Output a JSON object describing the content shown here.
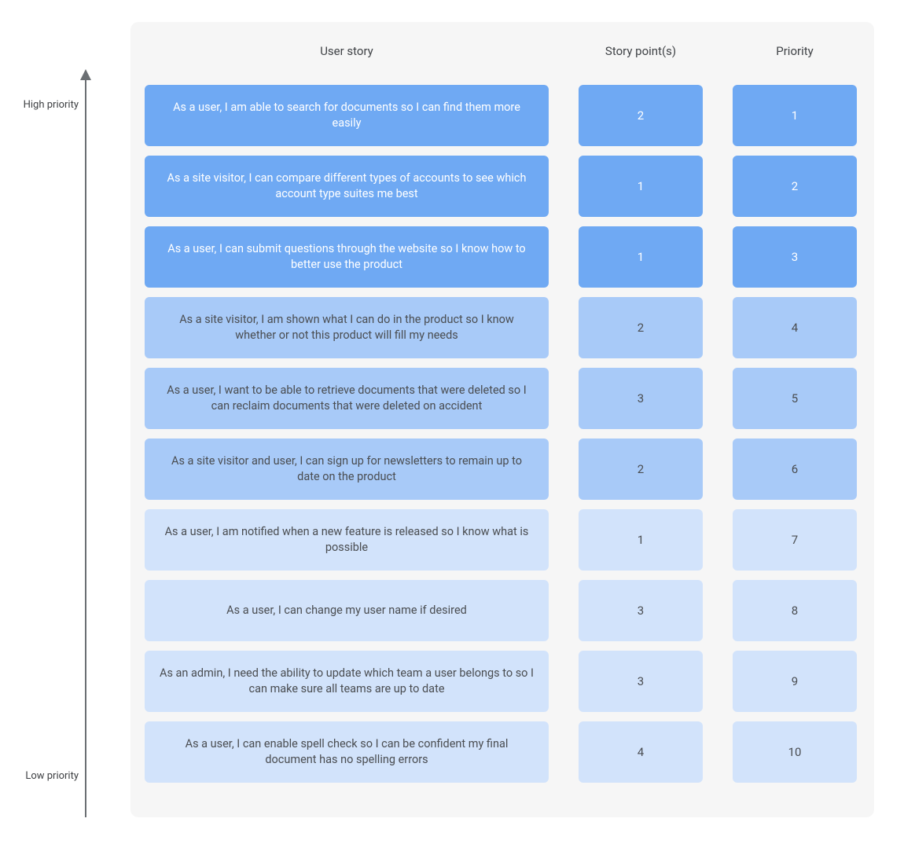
{
  "axis": {
    "high_label": "High priority",
    "low_label": "Low priority"
  },
  "headers": {
    "story": "User story",
    "points": "Story point(s)",
    "priority": "Priority"
  },
  "tiers": {
    "dark": "#6fa9f3",
    "mid": "#a8caf8",
    "light": "#d2e3fb"
  },
  "stories": [
    {
      "story": "As a user, I am able to search for documents so I can find them more easily",
      "points": "2",
      "priority": "1",
      "tier": "dark"
    },
    {
      "story": "As a site visitor, I can compare different types of accounts to see which account type suites me best",
      "points": "1",
      "priority": "2",
      "tier": "dark"
    },
    {
      "story": "As a user, I can submit questions through the website so I know how to better use the product",
      "points": "1",
      "priority": "3",
      "tier": "dark"
    },
    {
      "story": "As a site visitor, I am shown what I can do in the product so I know whether or not this product will fill my needs",
      "points": "2",
      "priority": "4",
      "tier": "mid"
    },
    {
      "story": "As a user, I want to be able to retrieve documents that were deleted so I can reclaim documents that were deleted on accident",
      "points": "3",
      "priority": "5",
      "tier": "mid"
    },
    {
      "story": "As a site visitor and user, I can sign up for newsletters to remain up to date on the product",
      "points": "2",
      "priority": "6",
      "tier": "mid"
    },
    {
      "story": "As a user, I am notified when a new feature is released so I know what is possible",
      "points": "1",
      "priority": "7",
      "tier": "light"
    },
    {
      "story": "As a user, I can change my user name if desired",
      "points": "3",
      "priority": "8",
      "tier": "light"
    },
    {
      "story": "As an admin, I need the ability to update which team a user belongs to so I can make sure all teams are up to date",
      "points": "3",
      "priority": "9",
      "tier": "light"
    },
    {
      "story": "As a user, I can enable spell check so I can be confident my final document has no spelling errors",
      "points": "4",
      "priority": "10",
      "tier": "light"
    }
  ]
}
